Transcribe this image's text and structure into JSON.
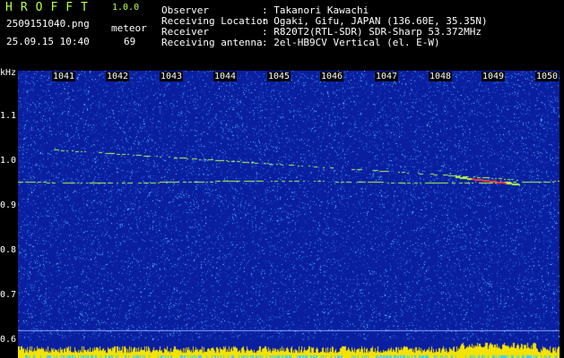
{
  "header": {
    "logo": "HROFFT",
    "version": "1.0.0",
    "filename": "2509151040.png",
    "datetime": "25.09.15 10:40",
    "category": "meteor",
    "count": "69"
  },
  "info": [
    {
      "label": "Observer",
      "value": ": Takanori Kawachi"
    },
    {
      "label": "Receiving Location",
      "value": ": Ogaki, Gifu, JAPAN (136.60E, 35.35N)"
    },
    {
      "label": "Receiver",
      "value": ": R820T2(RTL-SDR) SDR-Sharp 53.372MHz"
    },
    {
      "label": "Receiving antenna",
      "value": ": 2el-HB9CV Vertical (el. E-W)"
    }
  ],
  "axis": {
    "unit": "kHz",
    "time_ticks": [
      "1041",
      "1042",
      "1043",
      "1044",
      "1045",
      "1046",
      "1047",
      "1048",
      "1049",
      "1050"
    ],
    "freq_ticks": [
      "1.1",
      "1.0",
      "0.9",
      "0.8",
      "0.7",
      "0.6"
    ]
  },
  "colors": {
    "background": "#0a1fa0",
    "noise": "#3fa8ff",
    "signal": "#b7ff4a",
    "peak": "#ff3b3b",
    "floor": "#f4e300"
  }
}
